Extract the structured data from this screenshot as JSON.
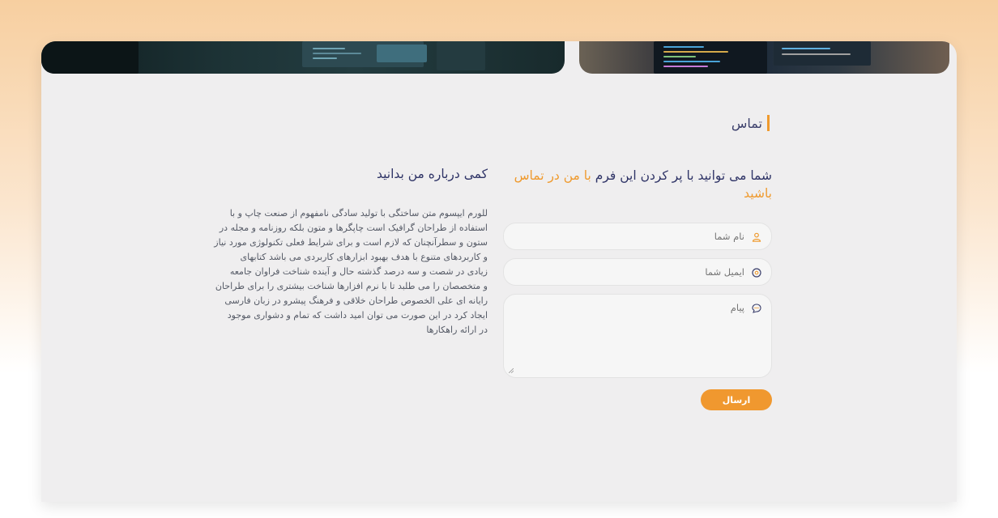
{
  "colors": {
    "accent": "#ef9a2e",
    "heading": "#2e3366",
    "background": "#efeeef"
  },
  "contact": {
    "section_title": "تماس",
    "form_heading_main": "شما می توانید با پر کردن این فرم ",
    "form_heading_accent": "با من در تماس باشید",
    "fields": {
      "name_placeholder": "نام شما",
      "name_icon": "user-icon",
      "email_placeholder": "ایمیل شما",
      "email_icon": "at-sign-icon",
      "message_placeholder": "پیام",
      "message_icon": "chat-bubble-icon"
    },
    "submit_label": "ارسال"
  },
  "about": {
    "heading": "کمی درباره من بدانید",
    "lines": [
      "للورم ایپسوم متن ساختگی با تولید سادگی نامفهوم از صنعت چاپ و با",
      "استفاده از طراحان گرافیک است چاپگرها و متون بلکه روزنامه و مجله در",
      "ستون و سطرآنچنان که لازم است و برای شرایط فعلی تکنولوژی مورد نیاز",
      "و کاربردهای متنوع با هدف بهبود ابزارهای کاربردی می باشد کتابهای",
      "زیادی در شصت و سه درصد گذشته حال و آینده شناخت فراوان جامعه",
      "و متخصصان را می طلبد تا با نرم افزارها شناخت بیشتری را برای طراحان",
      "رایانه ای علی الخصوص طراحان خلاقی و فرهنگ پیشرو در زبان فارسی",
      "ایجاد کرد در این صورت می توان امید داشت که تمام و دشواری موجود",
      "در ارائه راهکارها"
    ]
  }
}
